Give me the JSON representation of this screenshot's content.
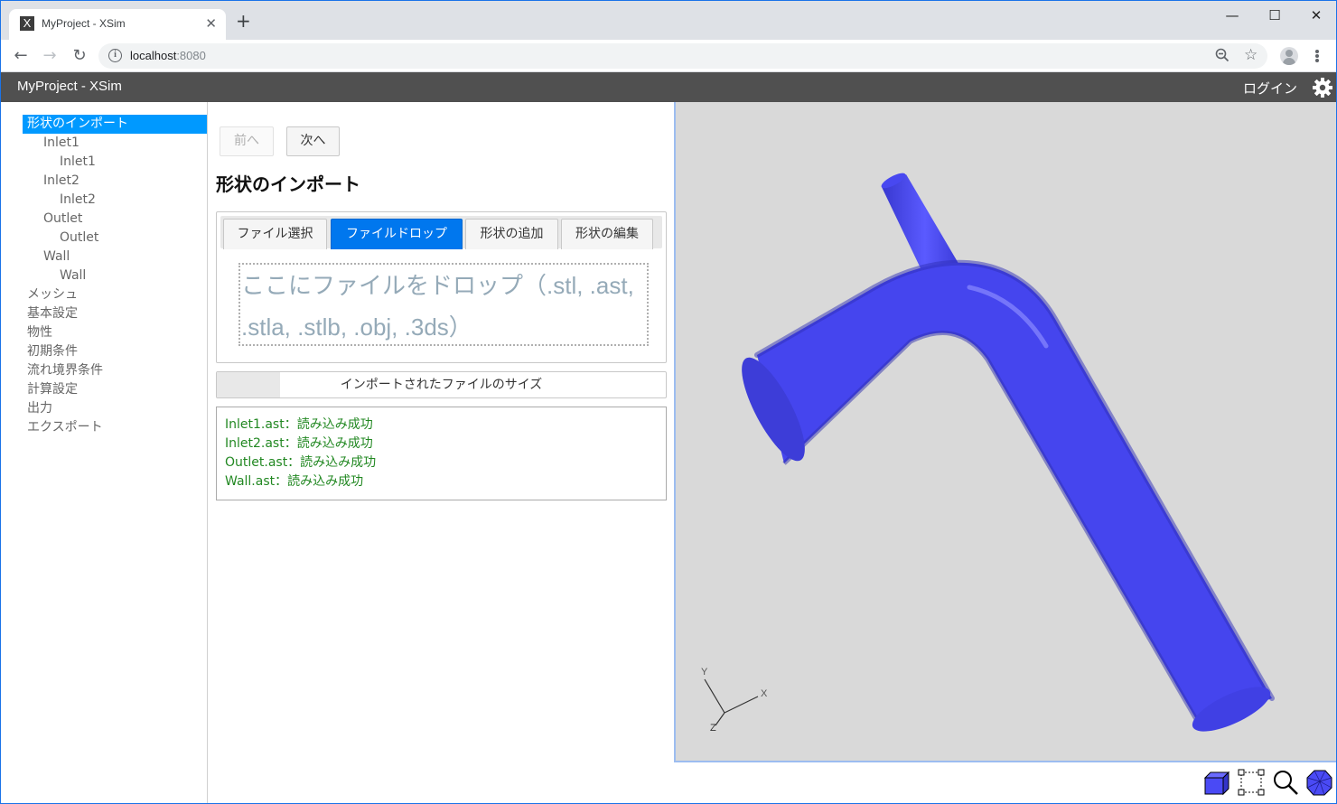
{
  "browser": {
    "tab_title": "MyProject - XSim",
    "tab_favicon": "X",
    "url_host": "localhost",
    "url_port": ":8080",
    "icons": {
      "back": "arrow-left-icon",
      "forward": "arrow-right-icon",
      "reload": "reload-icon",
      "info": "info-icon",
      "zoom": "zoom-out-icon",
      "bookmark": "star-icon",
      "profile": "profile-icon",
      "menu": "more-vert-icon"
    }
  },
  "app": {
    "title": "MyProject - XSim",
    "login_label": "ログイン"
  },
  "sidebar": {
    "items": [
      {
        "label": "形状のインポート",
        "level": 0,
        "active": true
      },
      {
        "label": "Inlet1",
        "level": 1
      },
      {
        "label": "Inlet1",
        "level": 2
      },
      {
        "label": "Inlet2",
        "level": 1
      },
      {
        "label": "Inlet2",
        "level": 2
      },
      {
        "label": "Outlet",
        "level": 1
      },
      {
        "label": "Outlet",
        "level": 2
      },
      {
        "label": "Wall",
        "level": 1
      },
      {
        "label": "Wall",
        "level": 2
      },
      {
        "label": "メッシュ",
        "level": 0
      },
      {
        "label": "基本設定",
        "level": 0
      },
      {
        "label": "物性",
        "level": 0
      },
      {
        "label": "初期条件",
        "level": 0
      },
      {
        "label": "流れ境界条件",
        "level": 0
      },
      {
        "label": "計算設定",
        "level": 0
      },
      {
        "label": "出力",
        "level": 0
      },
      {
        "label": "エクスポート",
        "level": 0
      }
    ]
  },
  "main": {
    "prev_label": "前へ",
    "next_label": "次へ",
    "title": "形状のインポート",
    "tabs": [
      {
        "label": "ファイル選択",
        "active": false
      },
      {
        "label": "ファイルドロップ",
        "active": true
      },
      {
        "label": "形状の追加",
        "active": false
      },
      {
        "label": "形状の編集",
        "active": false
      }
    ],
    "dropzone_text": "ここにファイルをドロップ（.stl, .ast, .stla, .stlb, .obj, .3ds）",
    "size_bar": {
      "label": "インポートされたファイルのサイズ",
      "fill_fraction": 0.14
    },
    "log": [
      "Inlet1.ast：読み込み成功",
      "Inlet2.ast：読み込み成功",
      "Outlet.ast：読み込み成功",
      "Wall.ast：読み込み成功"
    ]
  },
  "viewer": {
    "axes": {
      "x": "X",
      "y": "Y",
      "z": "Z"
    },
    "model_color": "#4a4af5",
    "background_color": "#d9d9d9",
    "tools": [
      "solid-view-icon",
      "selection-box-icon",
      "zoom-icon",
      "mesh-view-icon"
    ]
  }
}
